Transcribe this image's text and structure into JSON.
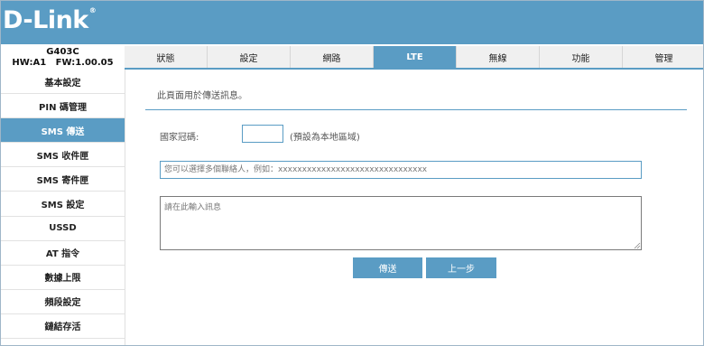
{
  "brand": {
    "logo": "D-Link",
    "reg": "®"
  },
  "device": {
    "model": "G403C",
    "hw": "HW:A1",
    "fw": "FW:1.00.05"
  },
  "tabs": [
    {
      "label": "狀態"
    },
    {
      "label": "設定"
    },
    {
      "label": "網路"
    },
    {
      "label": "LTE"
    },
    {
      "label": "無線"
    },
    {
      "label": "功能"
    },
    {
      "label": "管理"
    }
  ],
  "active_tab": "LTE",
  "sidebar": {
    "items": [
      {
        "label": "基本設定"
      },
      {
        "label": "PIN 碼管理"
      },
      {
        "label": "SMS 傳送"
      },
      {
        "label": "SMS 收件匣"
      },
      {
        "label": "SMS 寄件匣"
      },
      {
        "label": "SMS 設定"
      },
      {
        "label": "USSD"
      },
      {
        "label": "AT 指令"
      },
      {
        "label": "數據上限"
      },
      {
        "label": "頻段設定"
      },
      {
        "label": "鏈結存活"
      }
    ],
    "active": "SMS 傳送"
  },
  "main": {
    "intro": "此頁面用於傳送訊息。",
    "country_code_label": "國家冠碼:",
    "country_code_value": "",
    "country_code_note": "(預設為本地區域)",
    "recipients_placeholder": "您可以選擇多個聯絡人，例如：xxxxxxxxxxxxxxxxxxxxxxxxxxxxxxx",
    "message_placeholder": "請在此輸入訊息",
    "send_label": "傳送",
    "back_label": "上一步"
  },
  "colors": {
    "accent": "#5a9cc4",
    "tab_bg": "#f0f0f0"
  }
}
